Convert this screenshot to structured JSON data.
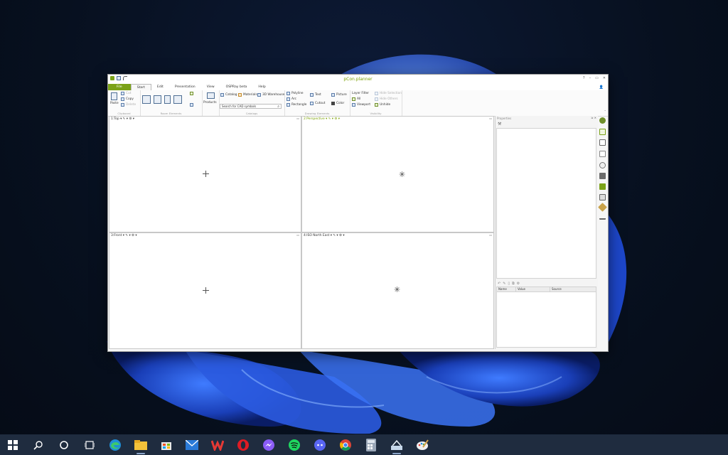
{
  "window": {
    "title": "pCon.planner",
    "help_button": "?",
    "min_button": "–",
    "restore_button": "▭",
    "close_button": "✕"
  },
  "menu": {
    "items": [
      "File",
      "Start",
      "Edit",
      "Presentation",
      "View",
      "OSPRay beta",
      "Help"
    ],
    "active": "Start"
  },
  "ribbon": {
    "clipboard": {
      "paste": "Paste",
      "cut": "Cut",
      "copy": "Copy",
      "delete": "Delete",
      "label": "Clipboard"
    },
    "room_elements": {
      "label": "Room Elements"
    },
    "products": {
      "label": "Products"
    },
    "catalogs": {
      "catalog": "Catalog",
      "materials": "Materials",
      "warehouse": "3D Warehouse",
      "search_placeholder": "Search for CAD symbols",
      "label": "Catalogs"
    },
    "drawing": {
      "polyline": "Polyline",
      "arc": "Arc",
      "rectangle": "Rectangle",
      "text": "Text",
      "cutout": "Cutout",
      "picture": "Picture",
      "color": "Color",
      "label": "Drawing Elements"
    },
    "visibility": {
      "layer_filter": "Layer Filter",
      "all": "All",
      "viewport": "Viewport",
      "hide_selection": "Hide Selection",
      "hide_others": "Hide Others",
      "unhide": "Unhide",
      "label": "Visibility"
    }
  },
  "viewports": [
    {
      "label": "1:Top",
      "green": false
    },
    {
      "label": "2:Perspective",
      "green": true
    },
    {
      "label": "3:Front",
      "green": false
    },
    {
      "label": "4:ISO North East",
      "green": false
    }
  ],
  "properties": {
    "title": "Properties",
    "columns": [
      "Name",
      "Value",
      "Source"
    ]
  },
  "colors": {
    "accent": "#7ba218",
    "title": "#7aa000",
    "taskbar": "#1f2c3f"
  },
  "taskbar_icons": [
    "windows-start-icon",
    "search-icon",
    "cortana-icon",
    "task-view-icon",
    "edge-icon",
    "file-explorer-icon",
    "microsoft-store-icon",
    "mail-icon",
    "wps-office-icon",
    "opera-icon",
    "messenger-icon",
    "spotify-icon",
    "discord-icon",
    "chrome-icon",
    "calculator-icon",
    "pcon-app-icon",
    "paint-icon"
  ]
}
